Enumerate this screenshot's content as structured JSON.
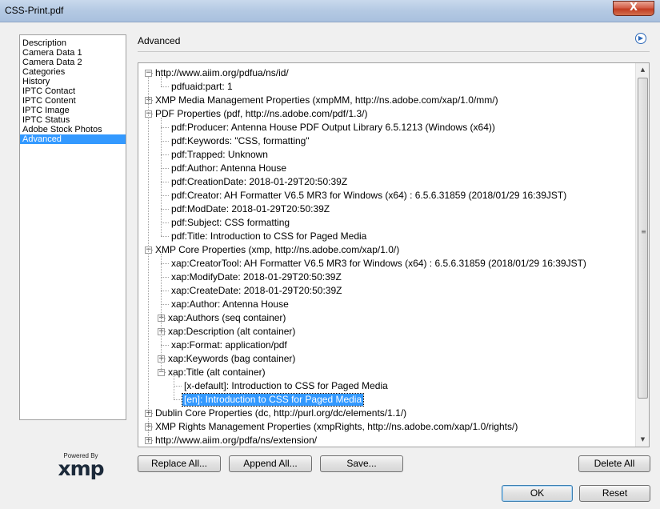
{
  "window": {
    "title": "CSS-Print.pdf",
    "close_label": "X"
  },
  "categories": [
    {
      "label": "Description",
      "selected": false
    },
    {
      "label": "Camera Data 1",
      "selected": false
    },
    {
      "label": "Camera Data 2",
      "selected": false
    },
    {
      "label": "Categories",
      "selected": false
    },
    {
      "label": "History",
      "selected": false
    },
    {
      "label": "IPTC Contact",
      "selected": false
    },
    {
      "label": "IPTC Content",
      "selected": false
    },
    {
      "label": "IPTC Image",
      "selected": false
    },
    {
      "label": "IPTC Status",
      "selected": false
    },
    {
      "label": "Adobe Stock Photos",
      "selected": false
    },
    {
      "label": "Advanced",
      "selected": true
    }
  ],
  "panel": {
    "header": "Advanced",
    "menu_icon": "circle-arrow-right-icon"
  },
  "tree": [
    {
      "depth": 0,
      "toggle": "-",
      "label": "http://www.aiim.org/pdfua/ns/id/"
    },
    {
      "depth": 1,
      "toggle": null,
      "label": "pdfuaid:part: 1"
    },
    {
      "depth": 0,
      "toggle": "+",
      "label": "XMP Media Management Properties (xmpMM, http://ns.adobe.com/xap/1.0/mm/)"
    },
    {
      "depth": 0,
      "toggle": "-",
      "label": "PDF Properties (pdf, http://ns.adobe.com/pdf/1.3/)"
    },
    {
      "depth": 1,
      "toggle": null,
      "label": "pdf:Producer: Antenna House PDF Output Library 6.5.1213 (Windows (x64))"
    },
    {
      "depth": 1,
      "toggle": null,
      "label": "pdf:Keywords: \"CSS, formatting\""
    },
    {
      "depth": 1,
      "toggle": null,
      "label": "pdf:Trapped: Unknown"
    },
    {
      "depth": 1,
      "toggle": null,
      "label": "pdf:Author: Antenna House"
    },
    {
      "depth": 1,
      "toggle": null,
      "label": "pdf:CreationDate: 2018-01-29T20:50:39Z"
    },
    {
      "depth": 1,
      "toggle": null,
      "label": "pdf:Creator: AH Formatter V6.5 MR3 for Windows (x64) : 6.5.6.31859 (2018/01/29 16:39JST)"
    },
    {
      "depth": 1,
      "toggle": null,
      "label": "pdf:ModDate: 2018-01-29T20:50:39Z"
    },
    {
      "depth": 1,
      "toggle": null,
      "label": "pdf:Subject: CSS formatting"
    },
    {
      "depth": 1,
      "toggle": null,
      "label": "pdf:Title: Introduction to CSS for Paged Media"
    },
    {
      "depth": 0,
      "toggle": "-",
      "label": "XMP Core Properties (xmp, http://ns.adobe.com/xap/1.0/)"
    },
    {
      "depth": 1,
      "toggle": null,
      "label": "xap:CreatorTool: AH Formatter V6.5 MR3 for Windows (x64) : 6.5.6.31859 (2018/01/29 16:39JST)"
    },
    {
      "depth": 1,
      "toggle": null,
      "label": "xap:ModifyDate: 2018-01-29T20:50:39Z"
    },
    {
      "depth": 1,
      "toggle": null,
      "label": "xap:CreateDate: 2018-01-29T20:50:39Z"
    },
    {
      "depth": 1,
      "toggle": null,
      "label": "xap:Author: Antenna House"
    },
    {
      "depth": 1,
      "toggle": "+",
      "label": "xap:Authors (seq container)"
    },
    {
      "depth": 1,
      "toggle": "+",
      "label": "xap:Description (alt container)"
    },
    {
      "depth": 1,
      "toggle": null,
      "label": "xap:Format: application/pdf"
    },
    {
      "depth": 1,
      "toggle": "+",
      "label": "xap:Keywords (bag container)"
    },
    {
      "depth": 1,
      "toggle": "-",
      "label": "xap:Title (alt container)"
    },
    {
      "depth": 2,
      "toggle": null,
      "label": "[x-default]: Introduction to CSS for Paged Media"
    },
    {
      "depth": 2,
      "toggle": null,
      "label": "[en]: Introduction to CSS for Paged Media",
      "selected": true
    },
    {
      "depth": 0,
      "toggle": "+",
      "label": "Dublin Core Properties (dc, http://purl.org/dc/elements/1.1/)"
    },
    {
      "depth": 0,
      "toggle": "+",
      "label": "XMP Rights Management Properties (xmpRights, http://ns.adobe.com/xap/1.0/rights/)"
    },
    {
      "depth": 0,
      "toggle": "+",
      "label": "http://www.aiim.org/pdfa/ns/extension/"
    }
  ],
  "scrollbar": {
    "thumb_start_fraction": 0.0,
    "thumb_extent_fraction": 0.9
  },
  "buttons": {
    "replace_all": "Replace All...",
    "append_all": "Append All...",
    "save": "Save...",
    "delete_all": "Delete All",
    "ok": "OK",
    "reset": "Reset"
  },
  "logo": {
    "powered_by": "Powered By",
    "mark": "xmp"
  }
}
